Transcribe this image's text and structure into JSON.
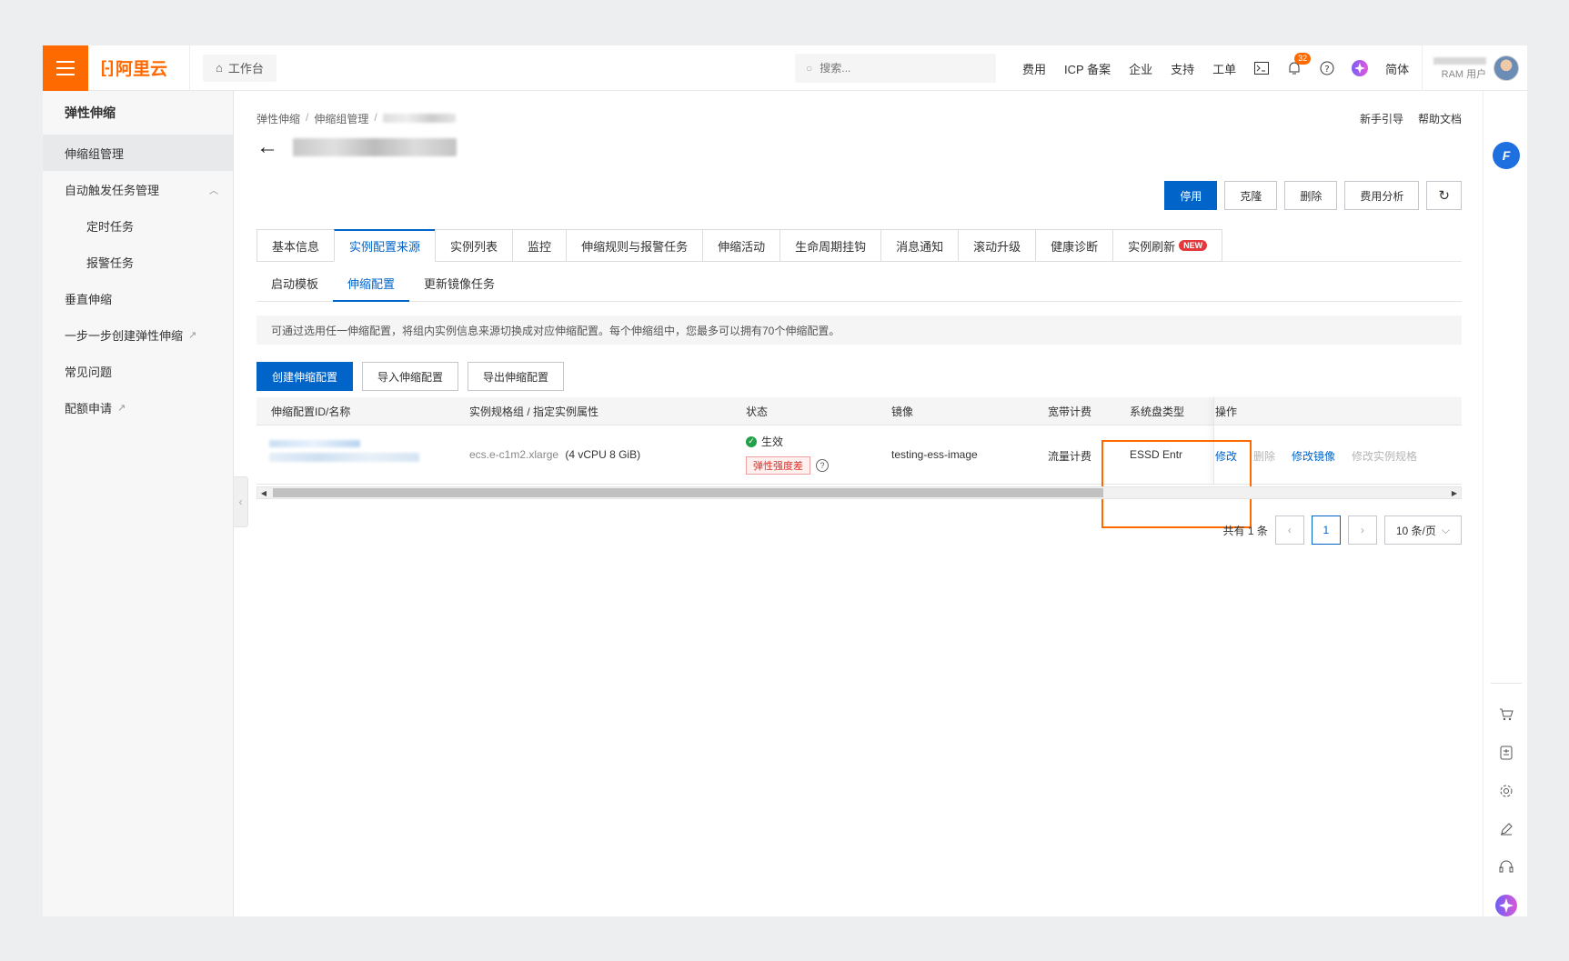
{
  "topbar": {
    "brand": "阿里云",
    "workbench": "工作台",
    "search_placeholder": "搜索...",
    "nav": [
      "费用",
      "ICP 备案",
      "企业",
      "支持",
      "工单"
    ],
    "notification_count": "32",
    "lang": "简体",
    "ram_label": "RAM 用户"
  },
  "sidebar": {
    "title": "弹性伸缩",
    "items": [
      {
        "label": "伸缩组管理"
      },
      {
        "label": "自动触发任务管理"
      },
      {
        "label": "定时任务"
      },
      {
        "label": "报警任务"
      },
      {
        "label": "垂直伸缩"
      },
      {
        "label": "一步一步创建弹性伸缩"
      },
      {
        "label": "常见问题"
      },
      {
        "label": "配额申请"
      }
    ]
  },
  "main": {
    "breadcrumb": [
      "弹性伸缩",
      "伸缩组管理"
    ],
    "help_links": [
      "新手引导",
      "帮助文档"
    ],
    "actions": [
      "停用",
      "克隆",
      "删除",
      "费用分析"
    ],
    "tabs": [
      "基本信息",
      "实例配置来源",
      "实例列表",
      "监控",
      "伸缩规则与报警任务",
      "伸缩活动",
      "生命周期挂钩",
      "消息通知",
      "滚动升级",
      "健康诊断",
      "实例刷新"
    ],
    "new_badge": "NEW",
    "subtabs": [
      "启动模板",
      "伸缩配置",
      "更新镜像任务"
    ],
    "notice": "可通过选用任一伸缩配置，将组内实例信息来源切换成对应伸缩配置。每个伸缩组中，您最多可以拥有70个伸缩配置。",
    "tool_buttons": [
      "创建伸缩配置",
      "导入伸缩配置",
      "导出伸缩配置"
    ],
    "table": {
      "headers": [
        "伸缩配置ID/名称",
        "实例规格组 / 指定实例属性",
        "状态",
        "镜像",
        "宽带计费",
        "系统盘类型",
        "操作"
      ],
      "row": {
        "instance_type": "ecs.e-c1m2.xlarge",
        "instance_spec": "(4 vCPU 8 GiB)",
        "status": "生效",
        "elastic_tag": "弹性强度差",
        "image": "testing-ess-image",
        "bandwidth": "流量计费",
        "disk": "ESSD Entr",
        "ops": [
          "修改",
          "删除",
          "修改镜像",
          "修改实例规格"
        ]
      }
    },
    "pager": {
      "total": "共有 1 条",
      "current": "1",
      "page_size": "10 条/页"
    }
  },
  "colors": {
    "brand": "#ff6a00",
    "primary": "#0064c8",
    "success": "#23a04a",
    "danger": "#d93026"
  }
}
